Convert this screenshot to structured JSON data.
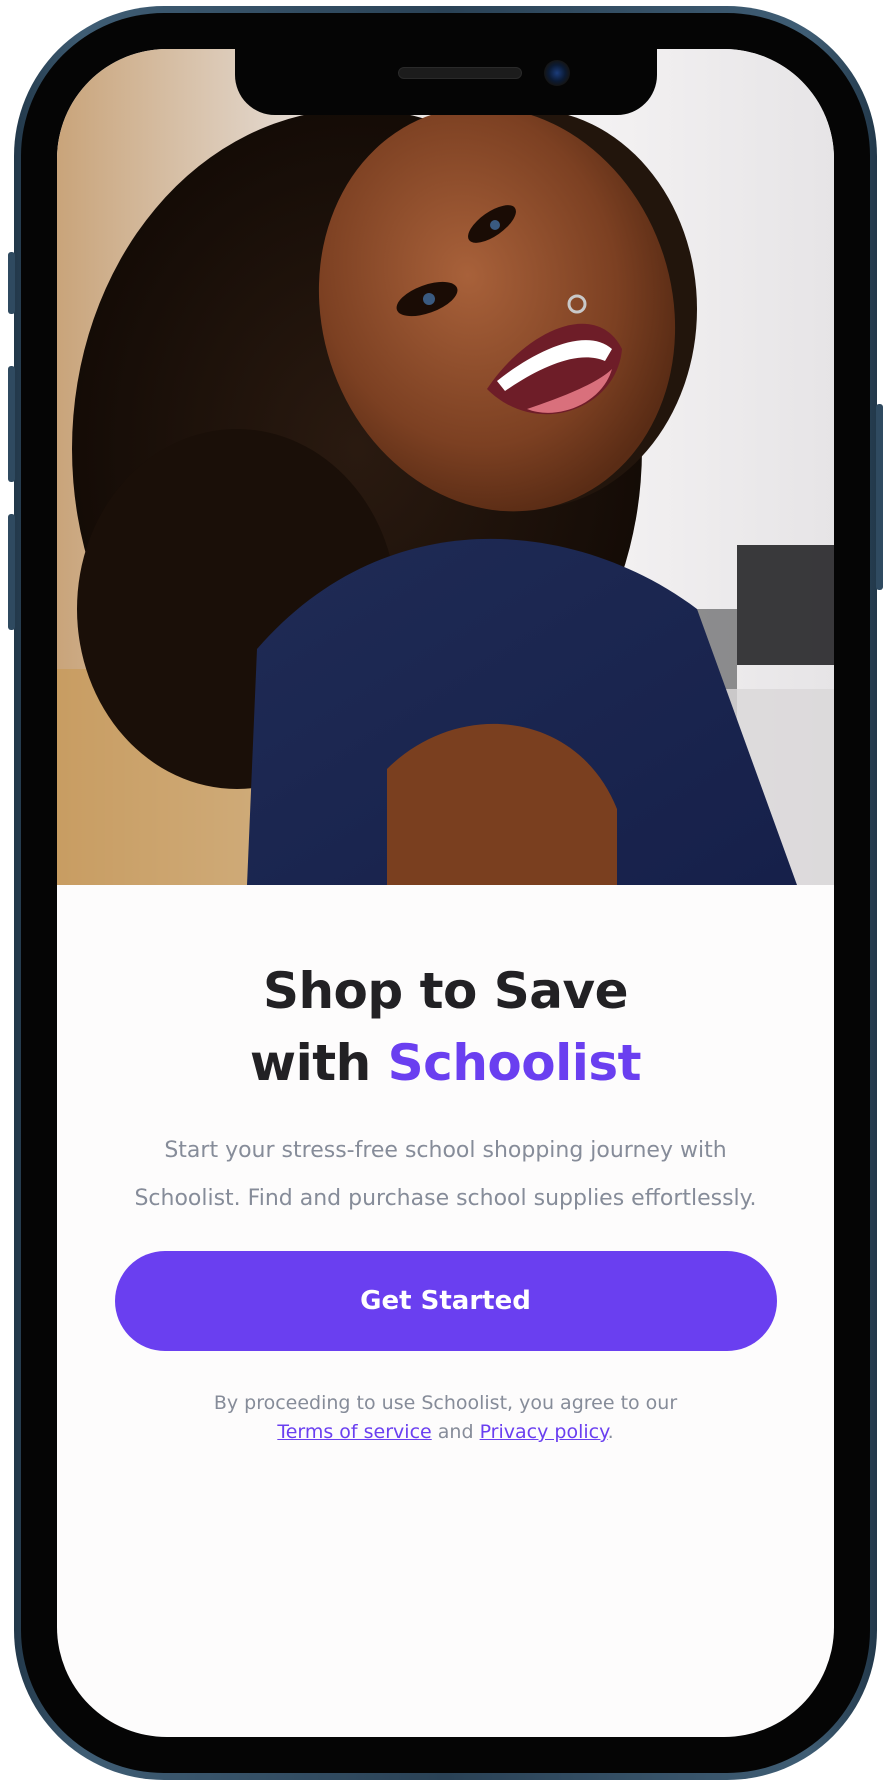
{
  "hero": {
    "image_description_icon": "smiling-student-photo"
  },
  "headline": {
    "line1": "Shop to Save",
    "line2_prefix": "with",
    "brand": "Schoolist"
  },
  "subtitle": {
    "line1": "Start your stress-free school shopping journey with",
    "line2": "Schoolist. Find and purchase school supplies effortlessly."
  },
  "cta": {
    "label": "Get Started"
  },
  "legal": {
    "line1": "By proceeding to use Schoolist, you agree to our",
    "terms_label": "Terms of service",
    "and_text": "and",
    "privacy_label": "Privacy policy",
    "end_punct": "."
  },
  "colors": {
    "accent": "#6a3ff0",
    "headline": "#222124",
    "body_text": "#868c99",
    "screen_bg": "#fdfcfc",
    "frame": "#2f4a60"
  }
}
